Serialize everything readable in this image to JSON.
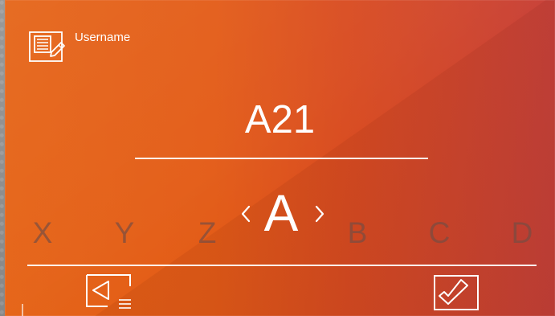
{
  "header": {
    "label": "Username",
    "icon": "notepad-pencil-icon"
  },
  "entry": {
    "value": "A21"
  },
  "selector": {
    "current": "A",
    "options": [
      "X",
      "Y",
      "Z",
      "B",
      "C",
      "D"
    ]
  },
  "controls": {
    "back_icon": "back-arrow-icon",
    "confirm_icon": "checkmark-icon"
  },
  "colors": {
    "panel_orange": "#e56316",
    "panel_red": "#c8433b",
    "text_white": "#ffffff",
    "muted_option": "#744c44"
  }
}
